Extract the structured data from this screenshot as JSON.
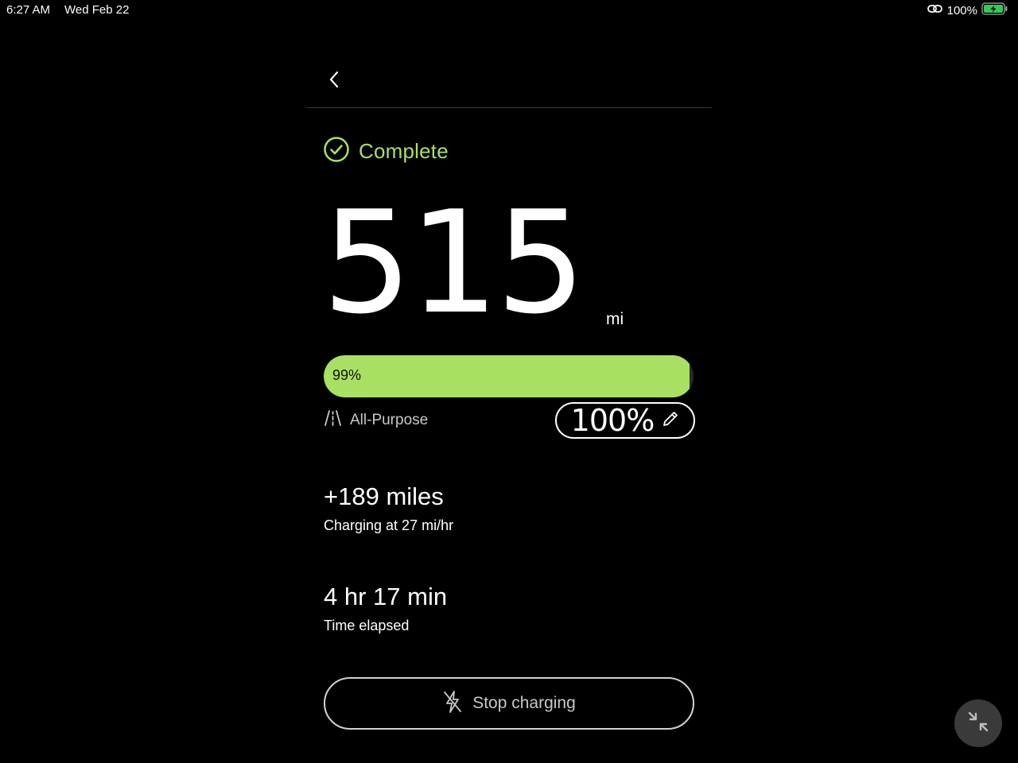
{
  "status_bar": {
    "time": "6:27 AM",
    "date": "Wed Feb 22",
    "battery_percent": "100%",
    "icons": [
      "link-icon",
      "battery-charging-icon"
    ]
  },
  "header": {
    "back_icon": "chevron-left-icon"
  },
  "charge_status": {
    "icon": "check-circle-icon",
    "label": "Complete",
    "color": "#a8e063"
  },
  "range": {
    "value": "515",
    "unit": "mi"
  },
  "battery": {
    "level_percent": 99,
    "level_label": "99%",
    "fill_color": "#a8e063",
    "mode_icon": "road-icon",
    "mode_label": "All-Purpose",
    "limit_label": "100%",
    "limit_edit_icon": "pencil-icon"
  },
  "stats": [
    {
      "value": "+189 miles",
      "label": "Charging at 27 mi/hr"
    },
    {
      "value": "4 hr 17 min",
      "label": "Time elapsed"
    }
  ],
  "actions": {
    "stop_icon": "no-charge-icon",
    "stop_label": "Stop charging",
    "minimize_icon": "minimize-arrows-icon"
  }
}
